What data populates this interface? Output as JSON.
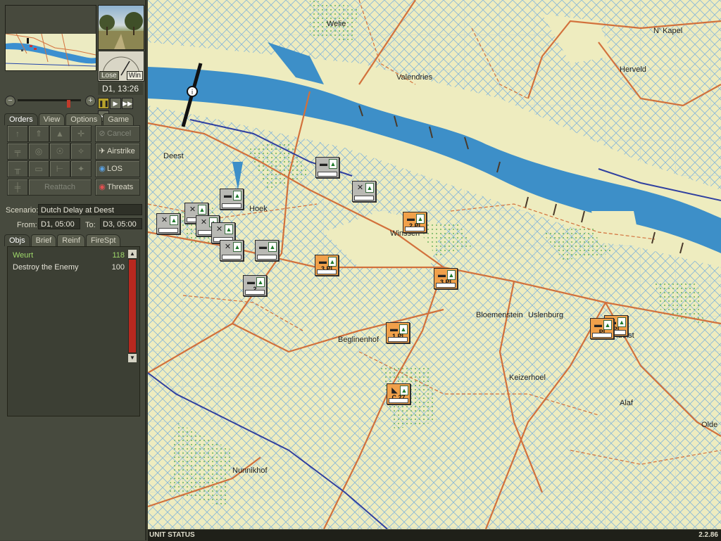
{
  "clock": "D1, 13:26",
  "gauge": {
    "lose": "Lose",
    "win": "Win"
  },
  "tabs_top": [
    {
      "label": "Orders",
      "active": true
    },
    {
      "label": "View",
      "active": false
    },
    {
      "label": "Options",
      "active": false
    },
    {
      "label": "Game",
      "active": false
    }
  ],
  "orders": {
    "cancel": "Cancel",
    "airstrike": "Airstrike",
    "los": "LOS",
    "threats": "Threats",
    "reattach": "Reattach"
  },
  "scenario": {
    "label": "Scenario:",
    "value": "Dutch Delay at Deest"
  },
  "from": {
    "label": "From:",
    "value": "D1, 05:00"
  },
  "to": {
    "label": "To:",
    "value": "D3, 05:00"
  },
  "tabs_bottom": [
    {
      "label": "Objs",
      "active": true
    },
    {
      "label": "Brief",
      "active": false
    },
    {
      "label": "Reinf",
      "active": false
    },
    {
      "label": "FireSpt",
      "active": false
    }
  ],
  "objectives": [
    {
      "name": "Weurt",
      "points": "118",
      "color": "#9fd86a"
    },
    {
      "name": "Destroy the Enemy",
      "points": "100",
      "color": "#e4e2d6"
    }
  ],
  "places": [
    "Welie",
    "N' Kapel",
    "Valendries",
    "Herveld",
    "Deest",
    "Hoek",
    "Winssen",
    "Bloemenstein",
    "Uslenburg",
    "Beglinenhof",
    "Andelst",
    "Keizerhoel",
    "Alaf",
    "Olde",
    "Nunnikhof"
  ],
  "units": [
    {
      "label": "",
      "color": "grey",
      "icon": "truck-icon"
    },
    {
      "label": "",
      "color": "grey",
      "icon": "infantry-icon"
    },
    {
      "label": "",
      "color": "grey",
      "icon": "truck-icon"
    },
    {
      "label": "",
      "color": "grey",
      "icon": "engineer-icon"
    },
    {
      "label": "",
      "color": "grey",
      "icon": "infantry-icon"
    },
    {
      "label": "",
      "color": "grey",
      "icon": "infantry-icon"
    },
    {
      "label": "",
      "color": "grey",
      "icon": "infantry-icon"
    },
    {
      "label": "",
      "color": "grey",
      "icon": "infantry-icon"
    },
    {
      "label": "",
      "color": "grey",
      "icon": "halftrack-icon"
    },
    {
      "label": "2",
      "color": "grey",
      "icon": "truck-icon"
    },
    {
      "label": "2.Pl",
      "color": "orange",
      "icon": "halftrack-icon"
    },
    {
      "label": "3.Pl",
      "color": "orange",
      "icon": "tank-icon"
    },
    {
      "label": "3.Pl",
      "color": "orange",
      "icon": "halftrack-icon"
    },
    {
      "label": "1.Pl",
      "color": "orange",
      "icon": "halftrack-icon"
    },
    {
      "label": "Pl",
      "color": "orange",
      "icon": "halftrack-icon"
    },
    {
      "label": "Pl",
      "color": "orange",
      "icon": "halftrack-icon"
    },
    {
      "label": "C.27",
      "color": "orange",
      "icon": "artillery-icon"
    }
  ],
  "status": {
    "left": "UNIT STATUS",
    "right": "2.2.86"
  }
}
